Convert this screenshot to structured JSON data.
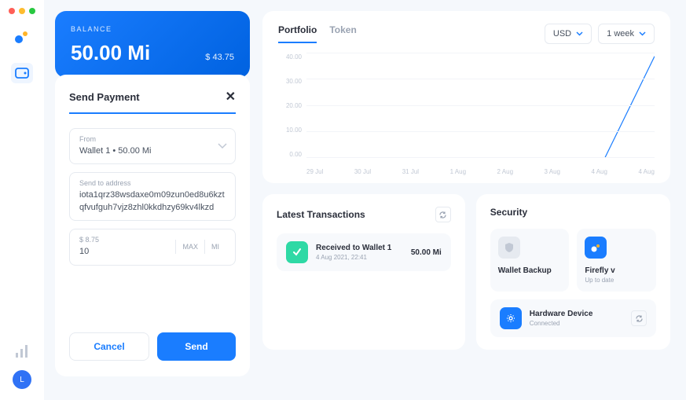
{
  "sidebar": {
    "avatar_initial": "L"
  },
  "balance": {
    "label": "BALANCE",
    "amount": "50.00 Mi",
    "fiat": "$ 43.75"
  },
  "payment": {
    "title": "Send Payment",
    "from_label": "From",
    "from_value": "Wallet 1 • 50.00 Mi",
    "address_label": "Send to address",
    "address_value": "iota1qrz38wsdaxe0m09zun0ed8u6kztqfvufguh7vjz8zhl0kkdhzy69kv4lkzd",
    "amount_fiat": "$ 8.75",
    "amount_value": "10",
    "max_label": "MAX",
    "unit_label": "MI",
    "cancel_label": "Cancel",
    "send_label": "Send"
  },
  "chart": {
    "tabs": {
      "portfolio": "Portfolio",
      "token": "Token"
    },
    "currency": "USD",
    "range": "1 week"
  },
  "chart_data": {
    "type": "line",
    "x": [
      "29 Jul",
      "30 Jul",
      "31 Jul",
      "1 Aug",
      "2 Aug",
      "3 Aug",
      "4 Aug",
      "4 Aug"
    ],
    "values": [
      0,
      0,
      0,
      0,
      0,
      0,
      0,
      43.75
    ],
    "ylabel": "",
    "xlabel": "",
    "y_ticks": [
      "0.00",
      "10.00",
      "20.00",
      "30.00",
      "40.00"
    ],
    "ylim": [
      0,
      45
    ]
  },
  "transactions": {
    "title": "Latest Transactions",
    "items": [
      {
        "title": "Received to Wallet 1",
        "date": "4 Aug 2021, 22:41",
        "amount": "50.00 Mi"
      }
    ]
  },
  "security": {
    "title": "Security",
    "backup": {
      "title": "Wallet Backup"
    },
    "firefly": {
      "title": "Firefly v",
      "sub": "Up to date"
    },
    "device": {
      "title": "Hardware Device",
      "status": "Connected"
    }
  }
}
